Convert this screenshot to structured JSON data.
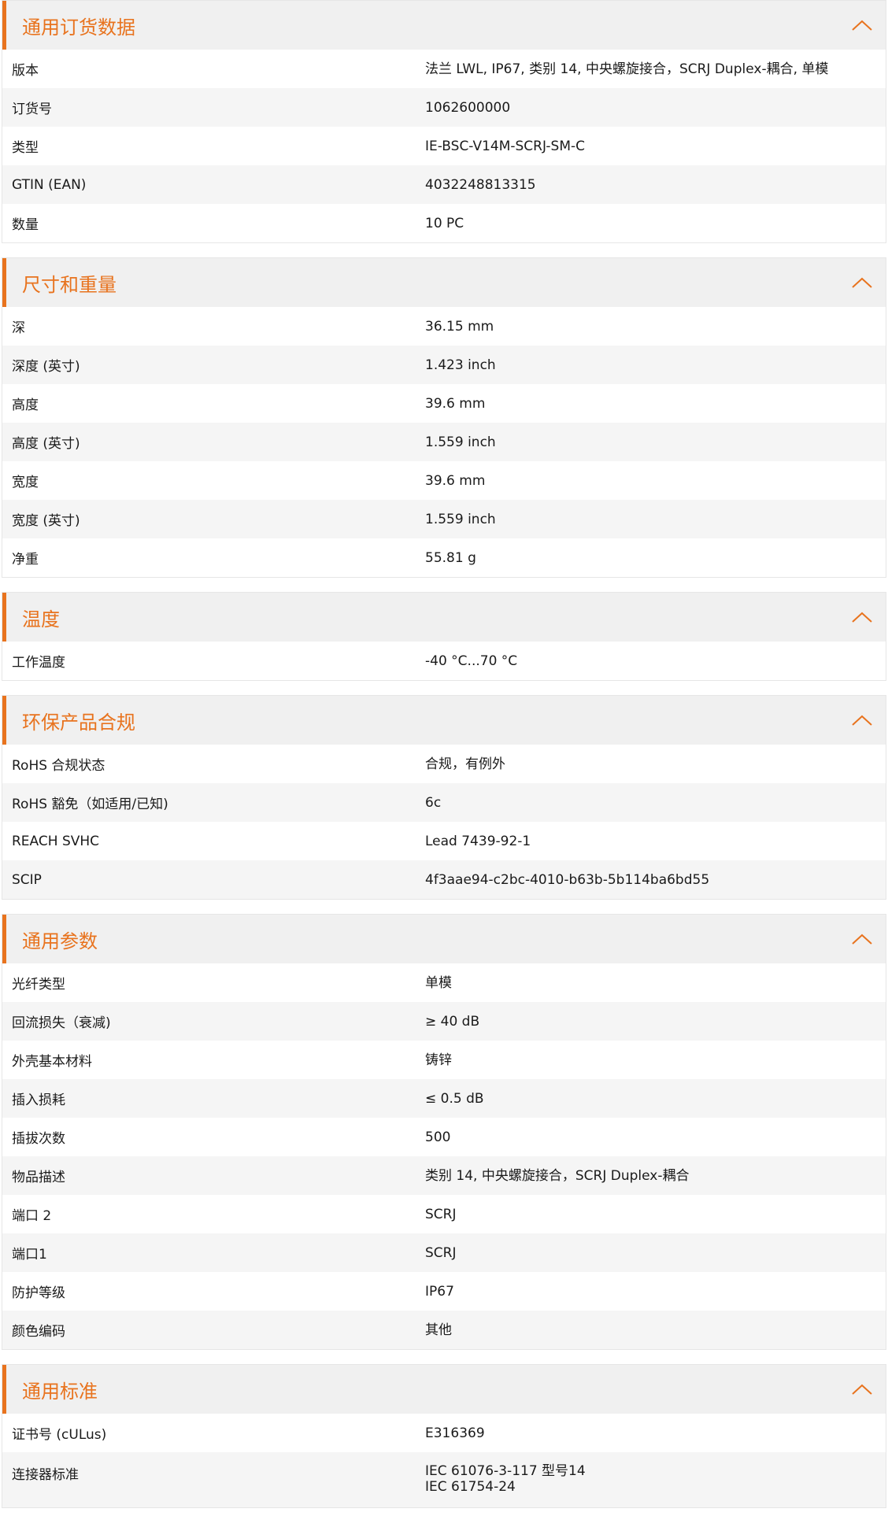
{
  "colors": {
    "accent": "#e8731e",
    "header_bg": "#f0f0f0",
    "row_alt_bg": "#f5f5f5"
  },
  "sections": [
    {
      "title": "通用订货数据",
      "rows": [
        {
          "label": "版本",
          "value": "法兰 LWL, IP67, 类别 14, 中央螺旋接合，SCRJ Duplex-耦合, 单模"
        },
        {
          "label": "订货号",
          "value": "1062600000"
        },
        {
          "label": "类型",
          "value": "IE-BSC-V14M-SCRJ-SM-C"
        },
        {
          "label": "GTIN (EAN)",
          "value": "4032248813315"
        },
        {
          "label": "数量",
          "value": "10  PC"
        }
      ]
    },
    {
      "title": "尺寸和重量",
      "rows": [
        {
          "label": "深",
          "value": "36.15  mm"
        },
        {
          "label": "深度 (英寸)",
          "value": "1.423  inch"
        },
        {
          "label": "高度",
          "value": "39.6  mm"
        },
        {
          "label": "高度 (英寸)",
          "value": "1.559  inch"
        },
        {
          "label": "宽度",
          "value": "39.6  mm"
        },
        {
          "label": "宽度 (英寸)",
          "value": "1.559  inch"
        },
        {
          "label": "净重",
          "value": "55.81  g"
        }
      ]
    },
    {
      "title": "温度",
      "rows": [
        {
          "label": "工作温度",
          "value": "-40 °C...70 °C"
        }
      ]
    },
    {
      "title": "环保产品合规",
      "rows": [
        {
          "label": "RoHS 合规状态",
          "value": "合规，有例外"
        },
        {
          "label": "RoHS 豁免（如适用/已知)",
          "value": "6c"
        },
        {
          "label": "REACH SVHC",
          "value": "Lead 7439-92-1"
        },
        {
          "label": "SCIP",
          "value": "4f3aae94-c2bc-4010-b63b-5b114ba6bd55"
        }
      ]
    },
    {
      "title": "通用参数",
      "rows": [
        {
          "label": "光纤类型",
          "value": "单模"
        },
        {
          "label": "回流损失（衰减)",
          "value": "≥ 40 dB"
        },
        {
          "label": "外壳基本材料",
          "value": "铸锌"
        },
        {
          "label": "插入损耗",
          "value": "≤ 0.5 dB"
        },
        {
          "label": "插拔次数",
          "value": "500"
        },
        {
          "label": "物品描述",
          "value": "类别 14, 中央螺旋接合，SCRJ Duplex-耦合"
        },
        {
          "label": "端口 2",
          "value": "SCRJ"
        },
        {
          "label": "端口1",
          "value": "SCRJ"
        },
        {
          "label": "防护等级",
          "value": "IP67"
        },
        {
          "label": "颜色编码",
          "value": "其他"
        }
      ]
    },
    {
      "title": "通用标准",
      "rows": [
        {
          "label": "证书号 (cULus)",
          "value": "E316369"
        },
        {
          "label": "连接器标准",
          "value": "IEC 61076-3-117 型号14",
          "value2": "IEC 61754-24"
        }
      ]
    }
  ]
}
